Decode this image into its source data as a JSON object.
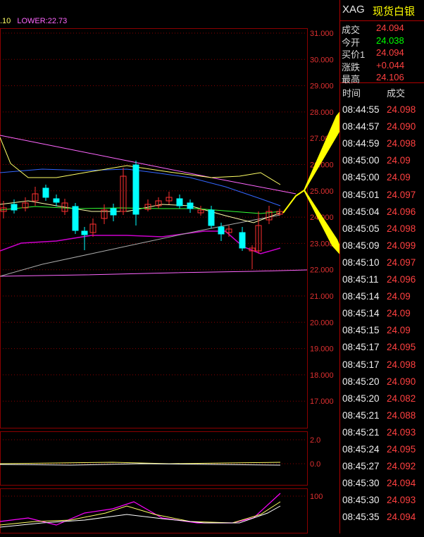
{
  "header": {
    "symbol": "XAG",
    "name": "现货白银"
  },
  "quote": [
    {
      "label": "成交",
      "value": "24.094",
      "color": "#ff4040"
    },
    {
      "label": "今开",
      "value": "24.038",
      "color": "#00ff00"
    },
    {
      "label": "买价1",
      "value": "24.094",
      "color": "#ff4040"
    },
    {
      "label": "涨跌",
      "value": "+0.044",
      "color": "#ff4040"
    },
    {
      "label": "最高",
      "value": "24.106",
      "color": "#ff4040"
    }
  ],
  "trade_list": {
    "col_time": "时间",
    "col_price": "成交",
    "rows": [
      {
        "time": "08:44:55",
        "price": "24.098"
      },
      {
        "time": "08:44:57",
        "price": "24.090"
      },
      {
        "time": "08:44:59",
        "price": "24.098"
      },
      {
        "time": "08:45:00",
        "price": "24.09"
      },
      {
        "time": "08:45:00",
        "price": "24.09"
      },
      {
        "time": "08:45:01",
        "price": "24.097"
      },
      {
        "time": "08:45:04",
        "price": "24.096"
      },
      {
        "time": "08:45:05",
        "price": "24.098"
      },
      {
        "time": "08:45:09",
        "price": "24.099"
      },
      {
        "time": "08:45:10",
        "price": "24.097"
      },
      {
        "time": "08:45:11",
        "price": "24.096"
      },
      {
        "time": "08:45:14",
        "price": "24.09"
      },
      {
        "time": "08:45:14",
        "price": "24.09"
      },
      {
        "time": "08:45:15",
        "price": "24.09"
      },
      {
        "time": "08:45:17",
        "price": "24.095"
      },
      {
        "time": "08:45:17",
        "price": "24.098"
      },
      {
        "time": "08:45:20",
        "price": "24.090"
      },
      {
        "time": "08:45:20",
        "price": "24.082"
      },
      {
        "time": "08:45:21",
        "price": "24.088"
      },
      {
        "time": "08:45:21",
        "price": "24.093"
      },
      {
        "time": "08:45:24",
        "price": "24.095"
      },
      {
        "time": "08:45:27",
        "price": "24.092"
      },
      {
        "time": "08:45:30",
        "price": "24.094"
      },
      {
        "time": "08:45:30",
        "price": "24.093"
      },
      {
        "time": "08:45:35",
        "price": "24.094"
      }
    ]
  },
  "indicator_top": {
    "left_text": ".10",
    "lower_text": "LOWER:22.73"
  },
  "price_axis": [
    "31.000",
    "30.000",
    "29.000",
    "28.000",
    "27.000",
    "26.000",
    "25.000",
    "24.000",
    "23.000",
    "22.000",
    "21.000",
    "20.000",
    "19.000",
    "18.000",
    "17.000"
  ],
  "sub1_axis": [
    "2.0",
    "0.0"
  ],
  "sub2_axis": [
    "100"
  ],
  "colors": {
    "up": "#ff3030",
    "down": "#00ffff",
    "grid": "#8b0000",
    "pink": "#ff66ff",
    "blue": "#3366ff",
    "yellow": "#ffff66",
    "arrow": "#ffff00"
  }
}
